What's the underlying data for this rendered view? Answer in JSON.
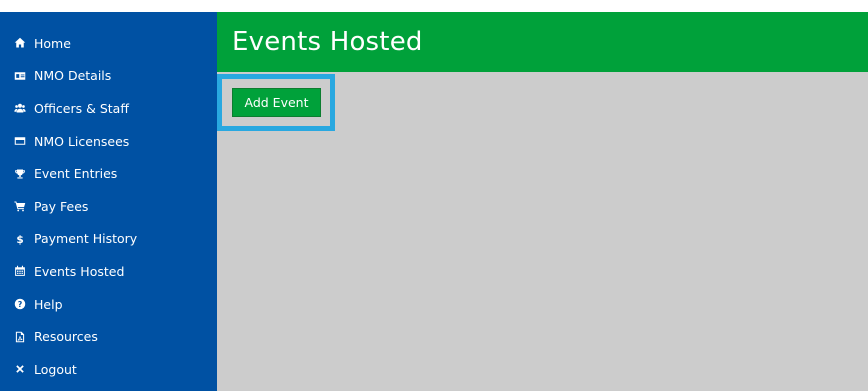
{
  "sidebar": {
    "items": [
      {
        "label": "Home",
        "icon": "home-icon"
      },
      {
        "label": "NMO Details",
        "icon": "id-card-icon"
      },
      {
        "label": "Officers & Staff",
        "icon": "users-icon"
      },
      {
        "label": "NMO Licensees",
        "icon": "credit-card-icon"
      },
      {
        "label": "Event Entries",
        "icon": "trophy-icon"
      },
      {
        "label": "Pay Fees",
        "icon": "cart-icon"
      },
      {
        "label": "Payment History",
        "icon": "dollar-icon"
      },
      {
        "label": "Events Hosted",
        "icon": "calendar-icon"
      },
      {
        "label": "Help",
        "icon": "question-icon"
      },
      {
        "label": "Resources",
        "icon": "pdf-file-icon"
      },
      {
        "label": "Logout",
        "icon": "close-icon"
      }
    ]
  },
  "header": {
    "title": "Events Hosted"
  },
  "main": {
    "add_event_label": "Add Event"
  },
  "colors": {
    "sidebar_bg": "#0051a3",
    "header_bg": "#00a13a",
    "content_bg": "#cccccc",
    "highlight": "#29a8e0"
  }
}
